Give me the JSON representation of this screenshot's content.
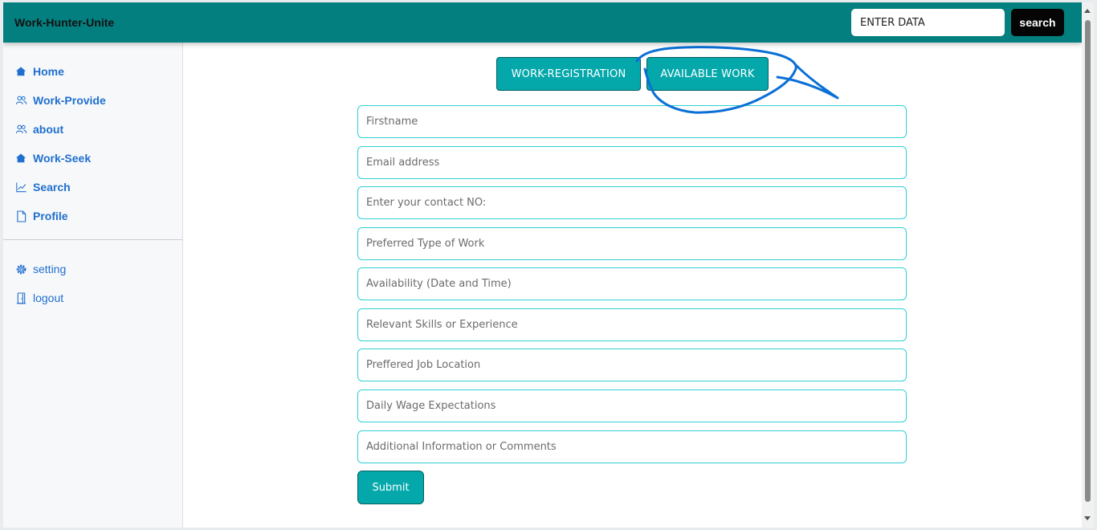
{
  "header": {
    "brand": "Work-Hunter-Unite",
    "search_value": "ENTER DATA",
    "search_button": "search"
  },
  "sidebar": {
    "items": [
      {
        "label": "Home",
        "icon": "home-icon"
      },
      {
        "label": "Work-Provide",
        "icon": "people-icon"
      },
      {
        "label": "about",
        "icon": "people-icon"
      },
      {
        "label": "Work-Seek",
        "icon": "home-icon"
      },
      {
        "label": "Search",
        "icon": "chart-line-icon"
      },
      {
        "label": "Profile",
        "icon": "document-icon"
      }
    ],
    "bottom_items": [
      {
        "label": "setting",
        "icon": "gear-icon"
      },
      {
        "label": "logout",
        "icon": "door-icon"
      }
    ]
  },
  "tabs": {
    "registration": "WORK-REGISTRATION",
    "available": "AVAILABLE WORK"
  },
  "form": {
    "fields": [
      {
        "placeholder": "Firstname"
      },
      {
        "placeholder": "Email address"
      },
      {
        "placeholder": "Enter your contact NO:"
      },
      {
        "placeholder": "Preferred Type of Work"
      },
      {
        "placeholder": "Availability (Date and Time)"
      },
      {
        "placeholder": "Relevant Skills or Experience"
      },
      {
        "placeholder": "Preffered Job Location"
      },
      {
        "placeholder": "Daily Wage Expectations"
      },
      {
        "placeholder": "Additional Information or Comments"
      }
    ],
    "submit": "Submit"
  },
  "colors": {
    "topbar": "#037f80",
    "button": "#04a8ab",
    "field_border": "#2fd0d3",
    "nav_link": "#1f6fcf",
    "annotation": "#0a6fd6"
  }
}
